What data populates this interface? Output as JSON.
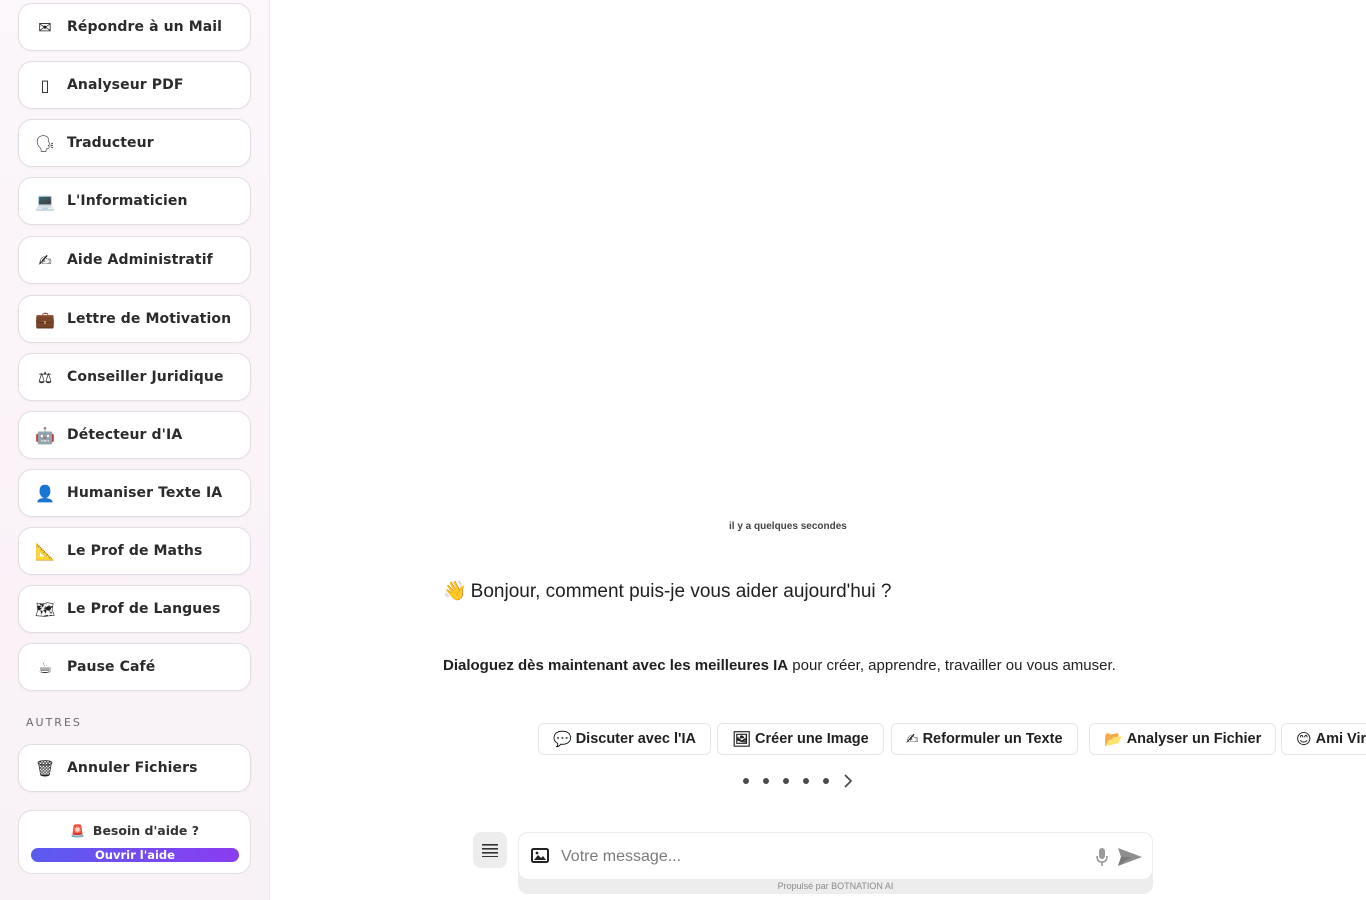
{
  "sidebar": {
    "items": [
      {
        "icon": "envelope-icon",
        "glyph": "✉",
        "label": "Répondre à un Mail"
      },
      {
        "icon": "document-icon",
        "glyph": "▯",
        "label": "Analyseur PDF"
      },
      {
        "icon": "speaking-head-icon",
        "glyph": "🗣",
        "label": "Traducteur"
      },
      {
        "icon": "laptop-icon",
        "glyph": "💻",
        "label": "L'Informaticien"
      },
      {
        "icon": "writing-hand-icon",
        "glyph": "✍",
        "label": "Aide Administratif"
      },
      {
        "icon": "briefcase-icon",
        "glyph": "💼",
        "label": "Lettre de Motivation"
      },
      {
        "icon": "scales-icon",
        "glyph": "⚖",
        "label": "Conseiller Juridique"
      },
      {
        "icon": "robot-icon",
        "glyph": "🤖",
        "label": "Détecteur d'IA"
      },
      {
        "icon": "person-icon",
        "glyph": "👤",
        "label": "Humaniser Texte IA"
      },
      {
        "icon": "triangle-ruler-icon",
        "glyph": "📐",
        "label": "Le Prof de Maths"
      },
      {
        "icon": "map-icon",
        "glyph": "🗺",
        "label": "Le Prof de Langues"
      },
      {
        "icon": "coffee-icon",
        "glyph": "☕",
        "label": "Pause Café"
      }
    ],
    "section_label": "AUTRES",
    "other_items": [
      {
        "icon": "wastebasket-icon",
        "glyph": "🗑",
        "label": "Annuler Fichiers"
      }
    ],
    "help": {
      "glyph": "🚨",
      "title": "Besoin d'aide ?",
      "button": "Ouvrir l'aide"
    }
  },
  "main": {
    "timestamp": "il y a quelques secondes",
    "greeting_glyph": "👋",
    "greeting": "Bonjour, comment puis-je vous aider aujourd'hui ?",
    "subline_bold": "Dialoguez dès maintenant avec les meilleures IA",
    "subline_rest": " pour créer, apprendre, travailler ou vous amuser.",
    "chips": [
      {
        "icon": "speech-bubble-icon",
        "glyph": "💬",
        "label": "Discuter avec l'IA"
      },
      {
        "icon": "picture-icon",
        "glyph": "🖼",
        "label": "Créer une Image"
      },
      {
        "icon": "writing-hand-icon",
        "glyph": "✍",
        "label": "Reformuler un Texte"
      },
      {
        "icon": "folder-icon",
        "glyph": "📂",
        "label": "Analyser un Fichier"
      },
      {
        "icon": "smiley-icon",
        "glyph": "😊",
        "label": "Ami Vir"
      }
    ],
    "carousel_dots": 5,
    "input_placeholder": "Votre message...",
    "powered_by": "Propulsé par BOTNATION AI"
  },
  "colors": {
    "accent_start": "#5b5bf0",
    "accent_end": "#8a3df0",
    "sidebar_bg": "#fbf5f9"
  }
}
